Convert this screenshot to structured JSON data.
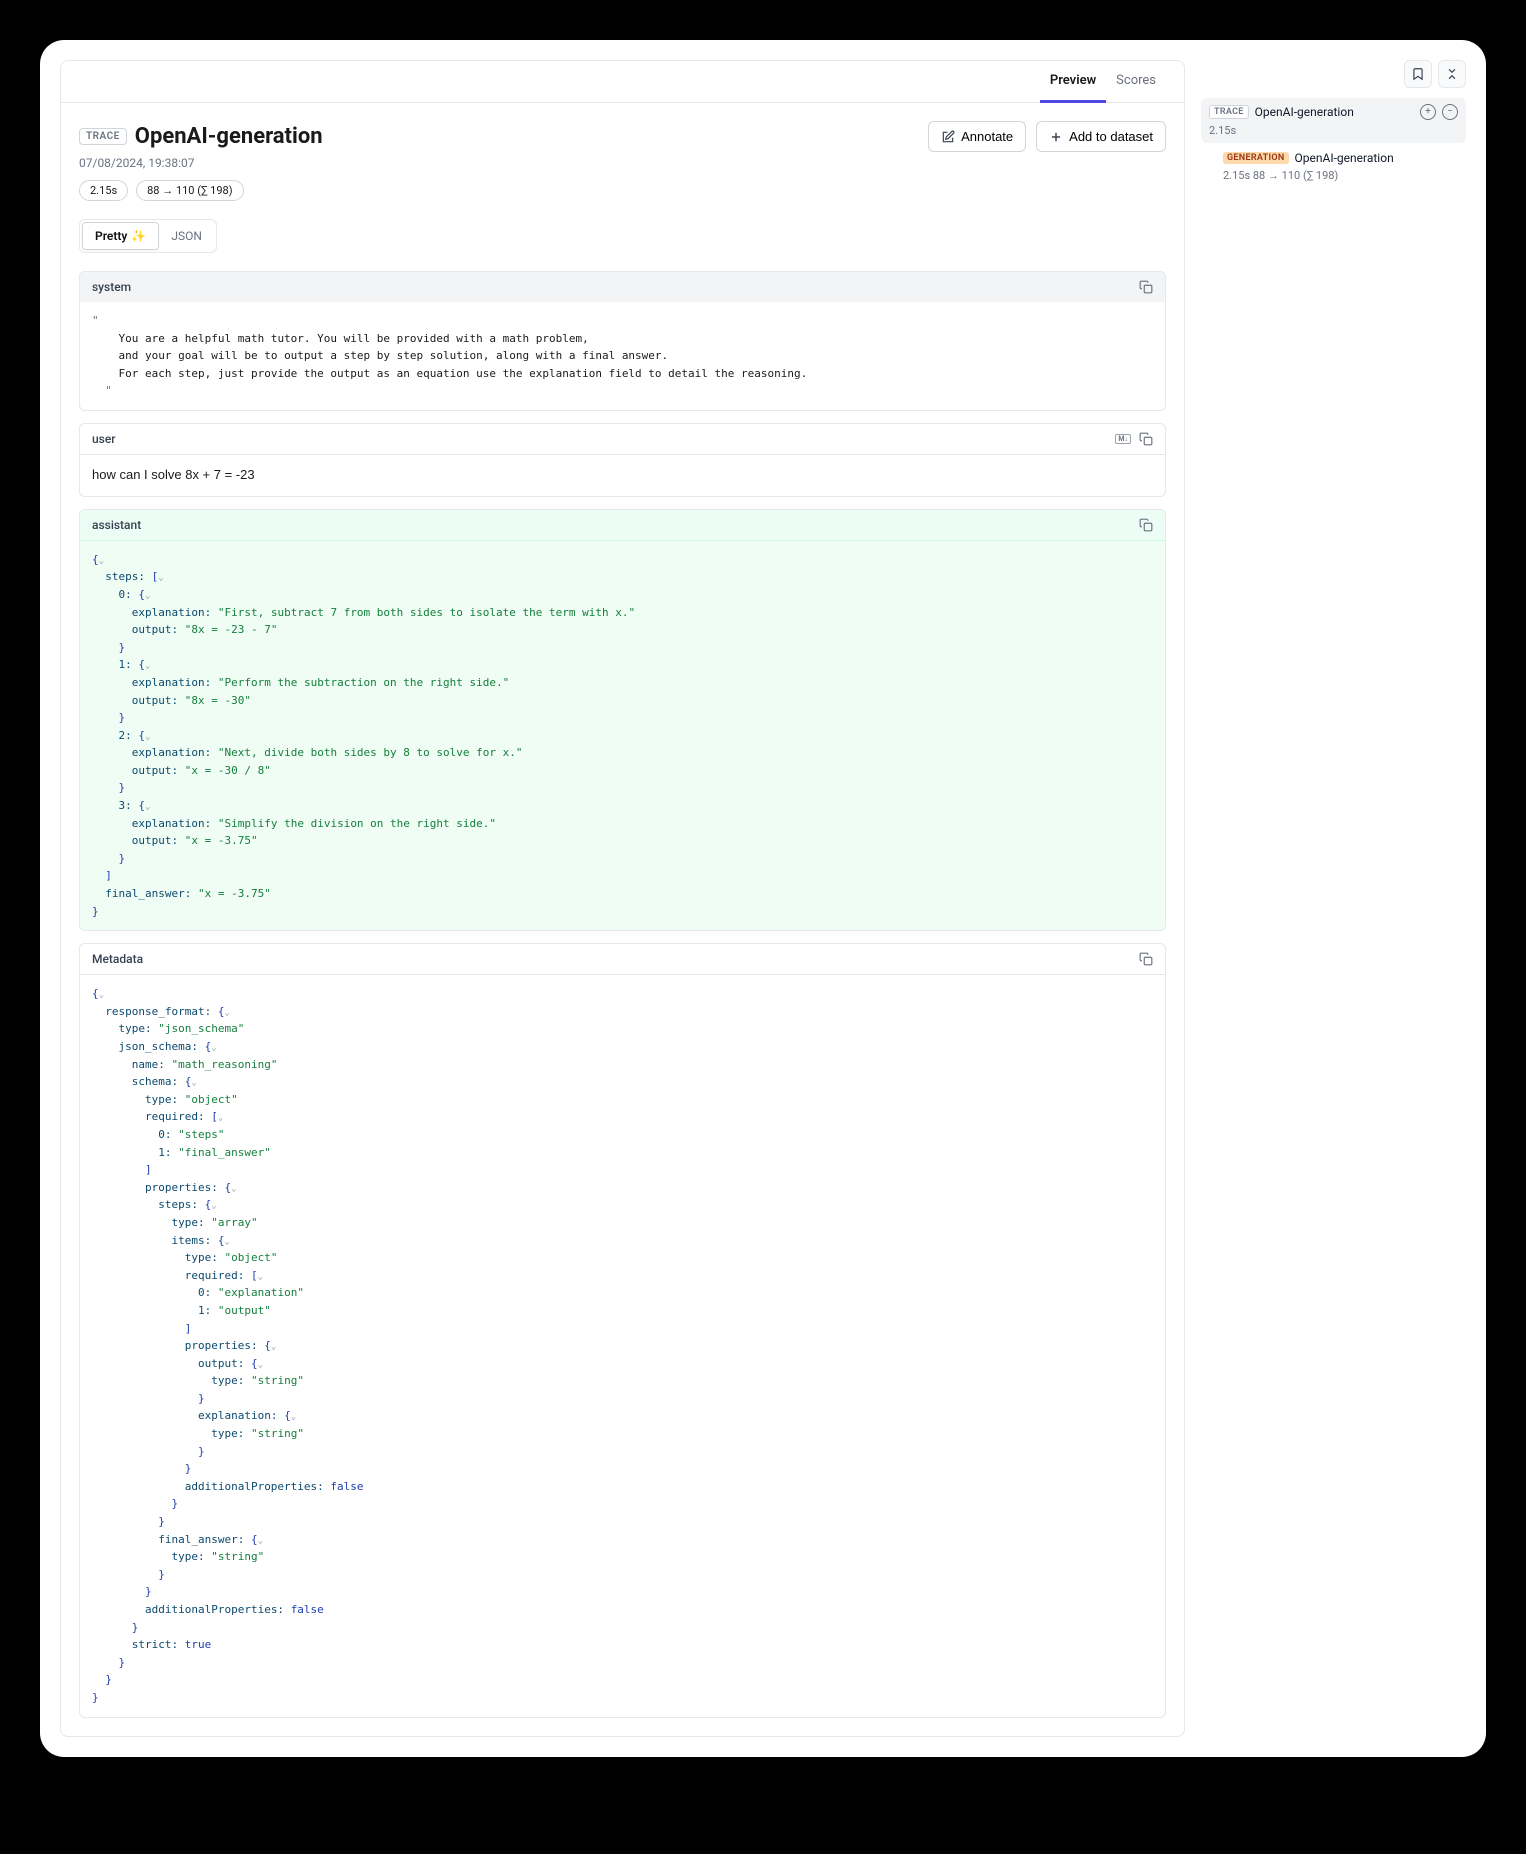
{
  "tabs": {
    "preview": "Preview",
    "scores": "Scores"
  },
  "header": {
    "badge": "TRACE",
    "title": "OpenAI-generation",
    "timestamp": "07/08/2024, 19:38:07",
    "latency_pill": "2.15s",
    "tokens_pill": "88 → 110 (∑ 198)",
    "annotate": "Annotate",
    "add_to_dataset": "Add to dataset"
  },
  "view": {
    "pretty": "Pretty",
    "json": "JSON"
  },
  "system": {
    "label": "system",
    "line1": "You are a helpful math tutor. You will be provided with a math problem,",
    "line2": "and your goal will be to output a step by step solution, along with a final answer.",
    "line3": "For each step, just provide the output as an equation use the explanation field to detail the reasoning."
  },
  "user": {
    "label": "user",
    "text": "how can I solve 8x + 7 = -23"
  },
  "assistant": {
    "label": "assistant",
    "steps": [
      {
        "explanation": "First, subtract 7 from both sides to isolate the term with x.",
        "output": "8x = -23 - 7"
      },
      {
        "explanation": "Perform the subtraction on the right side.",
        "output": "8x = -30"
      },
      {
        "explanation": "Next, divide both sides by 8 to solve for x.",
        "output": "x = -30 / 8"
      },
      {
        "explanation": "Simplify the division on the right side.",
        "output": "x = -3.75"
      }
    ],
    "final_answer": "x = -3.75"
  },
  "metadata_label": "Metadata",
  "metadata": {
    "response_format_type": "json_schema",
    "schema_name": "math_reasoning",
    "schema_type": "object",
    "req0": "steps",
    "req1": "final_answer",
    "steps_type": "array",
    "items_type": "object",
    "item_req0": "explanation",
    "item_req1": "output",
    "output_type": "string",
    "explanation_type": "string",
    "final_answer_type": "string",
    "additionalProperties": "false",
    "strict": "true"
  },
  "side": {
    "trace_badge": "TRACE",
    "trace_name": "OpenAI-generation",
    "trace_time": "2.15s",
    "gen_badge": "GENERATION",
    "gen_name": "OpenAI-generation",
    "gen_meta": "2.15s   88 → 110 (∑ 198)"
  }
}
